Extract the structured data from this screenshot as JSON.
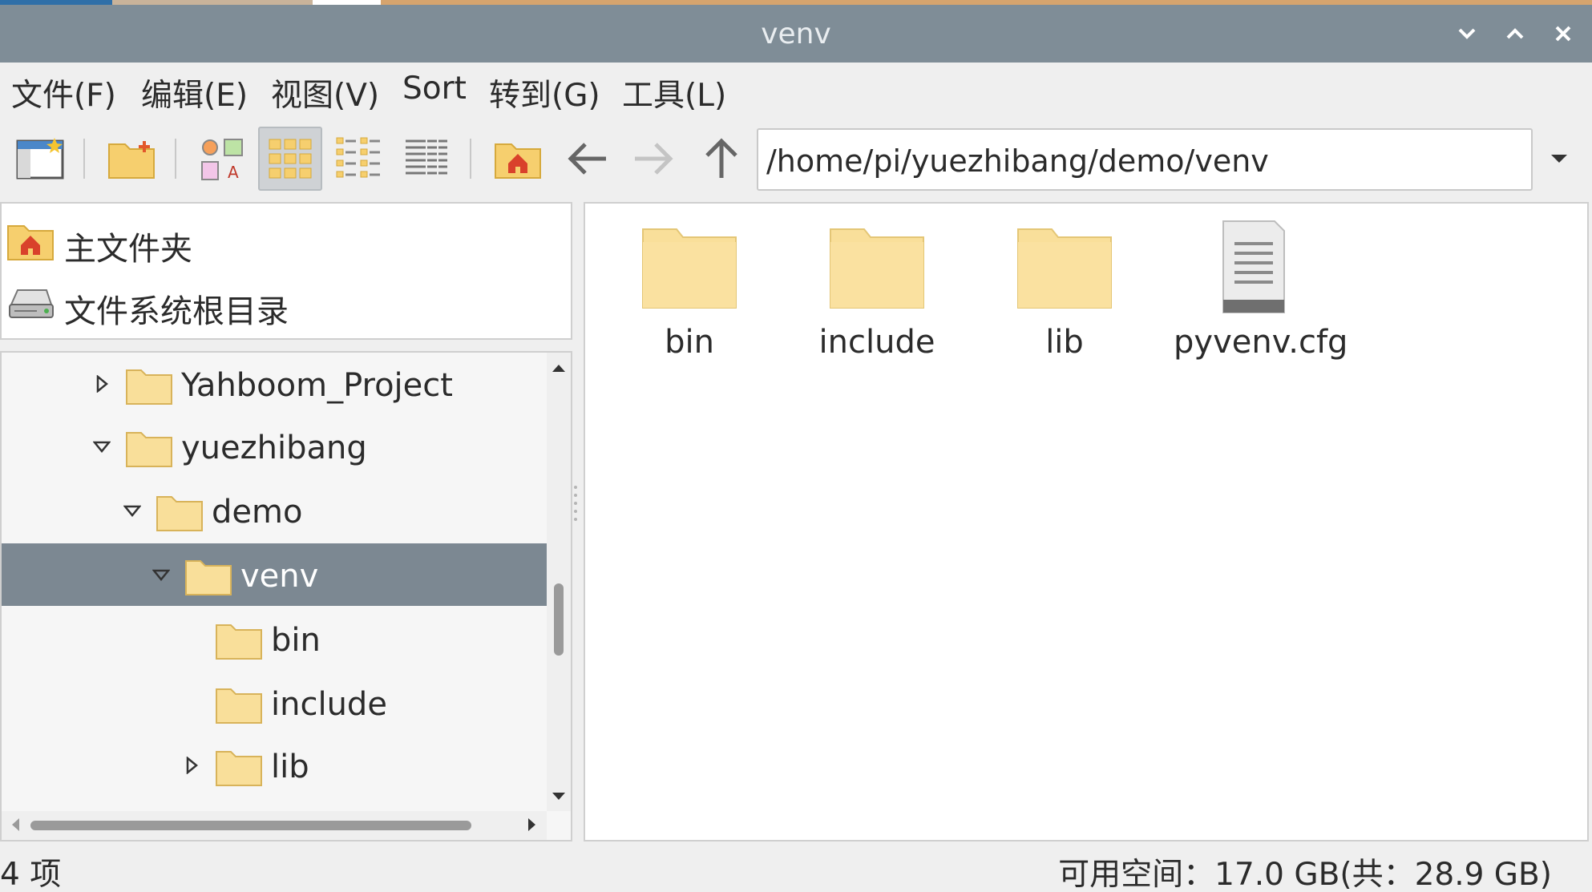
{
  "window": {
    "title": "venv"
  },
  "menu": {
    "file": "文件(F)",
    "edit": "编辑(E)",
    "view": "视图(V)",
    "sort": "Sort",
    "go": "转到(G)",
    "tools": "工具(L)"
  },
  "toolbar": {
    "location": "/home/pi/yuezhibang/demo/venv",
    "active_view": "icon-view"
  },
  "places": [
    {
      "label": "主文件夹",
      "icon": "home-folder-icon"
    },
    {
      "label": "文件系统根目录",
      "icon": "drive-icon"
    }
  ],
  "tree": [
    {
      "label": "Yahboom_Project",
      "state": "collapsed",
      "level": 3
    },
    {
      "label": "yuezhibang",
      "state": "expanded",
      "level": 3
    },
    {
      "label": "demo",
      "state": "expanded",
      "level": 4
    },
    {
      "label": "venv",
      "state": "expanded",
      "level": 5,
      "selected": true
    },
    {
      "label": "bin",
      "state": "none",
      "level": 6
    },
    {
      "label": "include",
      "state": "none",
      "level": 6
    },
    {
      "label": "lib",
      "state": "collapsed",
      "level": 6
    }
  ],
  "files": [
    {
      "name": "bin",
      "type": "folder"
    },
    {
      "name": "include",
      "type": "folder"
    },
    {
      "name": "lib",
      "type": "folder"
    },
    {
      "name": "pyvenv.cfg",
      "type": "text-file"
    }
  ],
  "status": {
    "count": "4 项",
    "free_space": "可用空间：17.0 GB(共：28.9 GB)"
  },
  "colors": {
    "titlebar": "#7f8d97",
    "selection": "#7c8892",
    "folder": "#f9df9a"
  }
}
